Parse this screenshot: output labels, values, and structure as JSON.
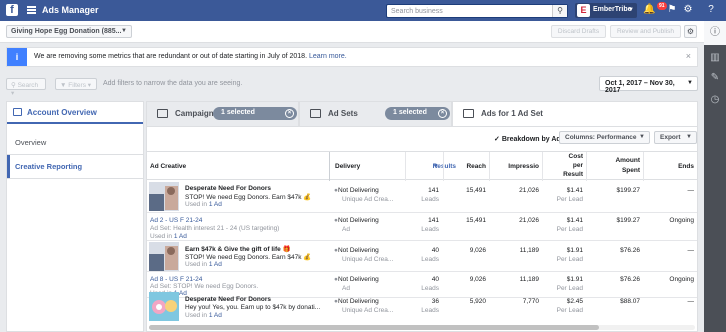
{
  "app": {
    "logo": "f",
    "title": "Ads Manager"
  },
  "search": {
    "placeholder": "Search business"
  },
  "account_menu": {
    "logo": "E",
    "name": "EmberTribe"
  },
  "notifications": {
    "count": "91"
  },
  "account_selector": {
    "value": "Giving Hope Egg Donation (885..."
  },
  "actions": {
    "discard": "Discard Drafts",
    "review": "Review and Publish"
  },
  "notice": {
    "text": "We are removing some metrics that are redundant or out of date starting in July of 2018.",
    "link": "Learn more."
  },
  "filters": {
    "search": "Search",
    "filters": "Filters",
    "hint": "Add filters to narrow the data you are seeing."
  },
  "date_range": "Oct 1, 2017 – Nov 30, 2017",
  "left_panel": {
    "tab": "Account Overview",
    "items": [
      "Overview",
      "Creative Reporting"
    ]
  },
  "tabs": {
    "campaigns": "Campaigns",
    "campaigns_selected": "1 selected",
    "adsets": "Ad Sets",
    "adsets_selected": "1 selected",
    "ads": "Ads for 1 Ad Set"
  },
  "toolbar": {
    "breakdown": "Breakdown by Ad",
    "columns": "Columns: Performance",
    "export": "Export"
  },
  "table": {
    "headers": {
      "creative": "Ad Creative",
      "delivery": "Delivery",
      "results": "Results",
      "reach": "Reach",
      "impressions": "Impressio",
      "cost": [
        "Cost",
        "per",
        "Result"
      ],
      "spent": [
        "Amount",
        "Spent"
      ],
      "ends": "Ends"
    },
    "rows": [
      {
        "title": "Desperate Need For Donors",
        "body": "STOP! We need Egg Donors. Earn $47k",
        "used_prefix": "Used in",
        "used_link": "1 Ad",
        "delivery": "Not Delivering",
        "delivery_sub": "Unique Ad Crea...",
        "results": "141",
        "results_sub": "Leads",
        "reach": "15,491",
        "impressions": "21,026",
        "cost": "$1.41",
        "cost_sub": "Per Lead",
        "spent": "$199.27",
        "ends": "—"
      },
      {
        "ad": "Ad 2 - US F 21-24",
        "adset": "Ad Set: Health interest 21 - 24 (US targeting)",
        "used_prefix": "Used in",
        "used_link": "1 Ad",
        "delivery": "Not Delivering",
        "delivery_sub": "Ad",
        "results": "141",
        "results_sub": "Leads",
        "reach": "15,491",
        "impressions": "21,026",
        "cost": "$1.41",
        "cost_sub": "Per Lead",
        "spent": "$199.27",
        "ends": "Ongoing"
      },
      {
        "title": "Earn $47k & Give the gift of life",
        "body": "STOP! We need Egg Donors. Earn $47k",
        "used_prefix": "Used in",
        "used_link": "1 Ad",
        "delivery": "Not Delivering",
        "delivery_sub": "Unique Ad Crea...",
        "results": "40",
        "results_sub": "Leads",
        "reach": "9,026",
        "impressions": "11,189",
        "cost": "$1.91",
        "cost_sub": "Per Lead",
        "spent": "$76.26",
        "ends": "—"
      },
      {
        "ad": "Ad 8 - US F 21-24",
        "adset": "Ad Set: STOP! We need Egg Donors.",
        "used_prefix": "Used in",
        "used_link": "1 Ad",
        "delivery": "Not Delivering",
        "delivery_sub": "Ad",
        "results": "40",
        "results_sub": "Leads",
        "reach": "9,026",
        "impressions": "11,189",
        "cost": "$1.91",
        "cost_sub": "Per Lead",
        "spent": "$76.26",
        "ends": "Ongoing"
      },
      {
        "title": "Desperate Need For Donors",
        "body": "Hey you! Yes, you. Earn up to $47k by donati...",
        "used_prefix": "Used in",
        "used_link": "1 Ad",
        "delivery": "Not Delivering",
        "delivery_sub": "Unique Ad Crea...",
        "results": "36",
        "results_sub": "Leads",
        "reach": "5,920",
        "impressions": "7,770",
        "cost": "$2.45",
        "cost_sub": "Per Lead",
        "spent": "$88.07",
        "ends": "—"
      }
    ]
  }
}
